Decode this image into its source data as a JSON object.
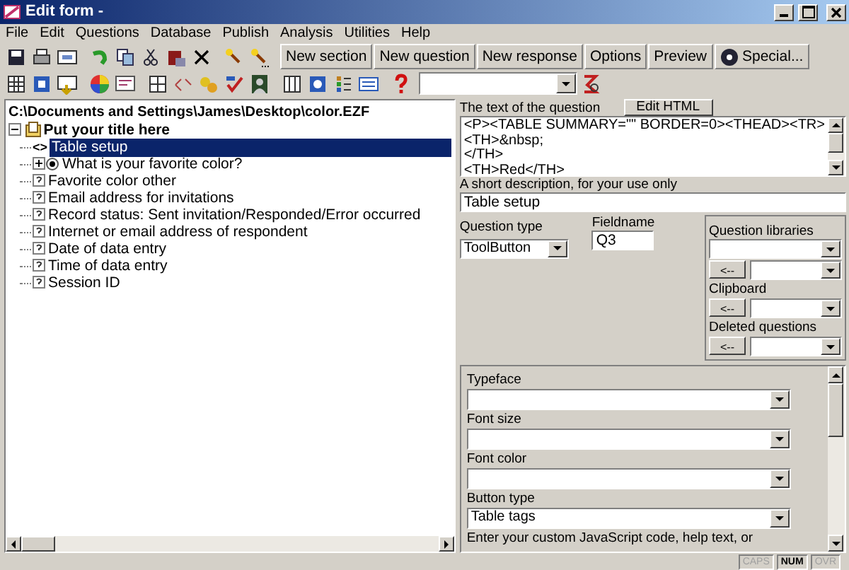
{
  "window": {
    "title": "Edit form -"
  },
  "menu": [
    "File",
    "Edit",
    "Questions",
    "Database",
    "Publish",
    "Analysis",
    "Utilities",
    "Help"
  ],
  "toolbar": {
    "buttons": [
      {
        "label": "New section",
        "kind": "text"
      },
      {
        "label": "New question",
        "kind": "text"
      },
      {
        "label": "New response",
        "kind": "text"
      },
      {
        "label": "Options",
        "kind": "text"
      },
      {
        "label": "Preview",
        "kind": "text"
      },
      {
        "label": "Special...",
        "kind": "icon-text"
      }
    ]
  },
  "tree": {
    "path": "C:\\Documents and Settings\\James\\Desktop\\color.EZF",
    "root": {
      "label": "Put your title here",
      "expanded": true,
      "children": [
        {
          "label": "Table setup",
          "kind": "html",
          "marker": "<>",
          "selected": true
        },
        {
          "label": "What is your favorite color?",
          "kind": "choice",
          "expanded": false,
          "selected": false
        },
        {
          "label": "Favorite color other",
          "kind": "field",
          "selected": false
        },
        {
          "label": "Email address for invitations",
          "kind": "field",
          "selected": false
        },
        {
          "label": "Record status: Sent invitation/Responded/Error occurred",
          "kind": "field",
          "selected": false
        },
        {
          "label": "Internet or email address of respondent",
          "kind": "field",
          "selected": false
        },
        {
          "label": "Date of data entry",
          "kind": "field",
          "selected": false
        },
        {
          "label": "Time of data entry",
          "kind": "field",
          "selected": false
        },
        {
          "label": "Session ID",
          "kind": "field",
          "selected": false
        }
      ]
    }
  },
  "question": {
    "text_label": "The text of the question",
    "edit_button": "Edit HTML",
    "text_lines": [
      "<P><TABLE SUMMARY=\"\" BORDER=0><THEAD><TR>",
      "<TH>&nbsp;",
      "</TH>",
      "<TH>Red</TH>"
    ],
    "description_label": "A short description, for your use only",
    "description": "Table setup",
    "type_label": "Question type",
    "type": "ToolButton",
    "fieldname_label": "Fieldname",
    "fieldname": "Q3",
    "libraries_label": "Question libraries",
    "clipboard_label": "Clipboard",
    "deleted_label": "Deleted questions",
    "copy_button": [
      "<--",
      "<--",
      "<--"
    ]
  },
  "properties": [
    {
      "label": "Typeface"
    },
    {
      "label": "Font size"
    },
    {
      "label": "Font color"
    },
    {
      "label": "Button type",
      "value": "Table tags"
    }
  ],
  "properties_note": "Enter your custom JavaScript code, help text, or",
  "status_bar": {
    "indicators": [
      {
        "label": "CAPS",
        "on": false
      },
      {
        "label": "NUM",
        "on": true
      },
      {
        "label": "OVR",
        "on": false
      }
    ]
  }
}
